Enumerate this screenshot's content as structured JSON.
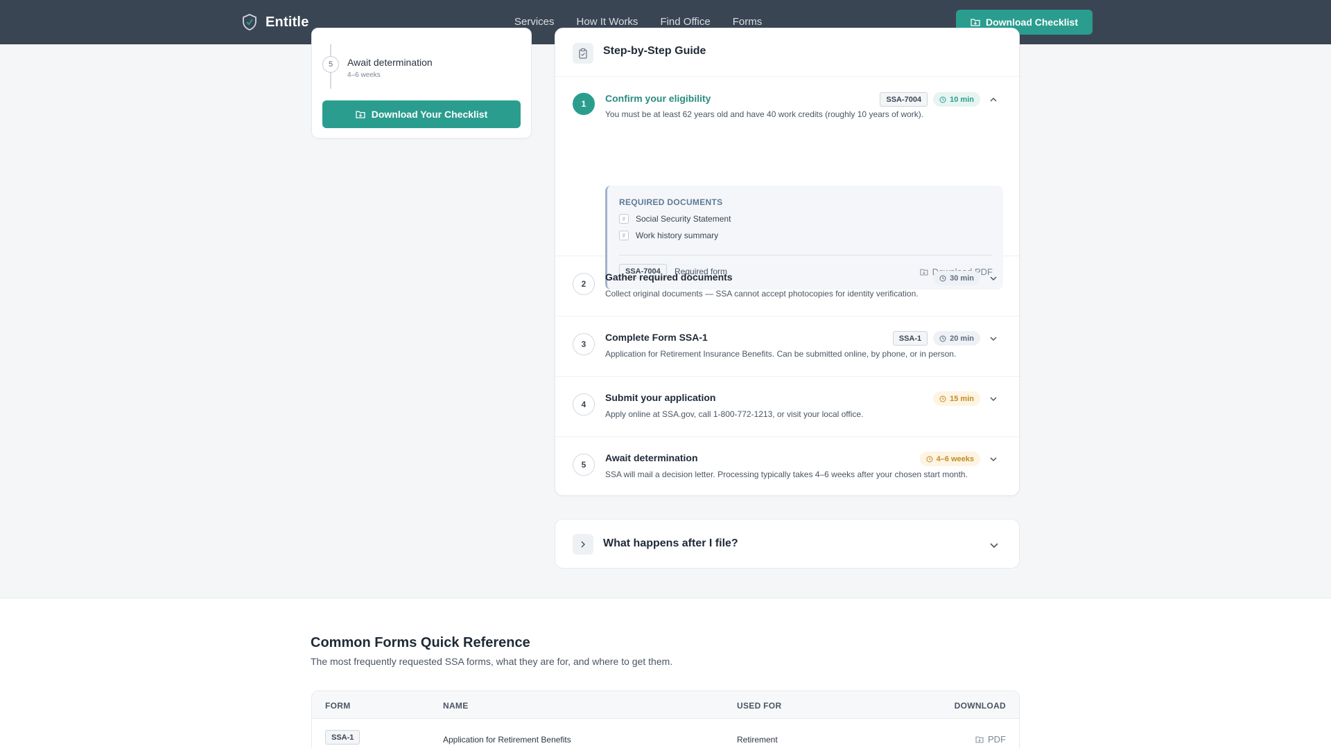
{
  "app": {
    "brand": "Entitle",
    "nav": [
      "Services",
      "How It Works",
      "Find Office",
      "Forms"
    ],
    "cta": "Download Checklist"
  },
  "sidebar": {
    "step_number": "5",
    "step_title": "Await determination",
    "step_duration": "4–6 weeks",
    "download_button": "Download Your Checklist"
  },
  "guide": {
    "title": "Step-by-Step Guide",
    "steps": [
      {
        "number": "1",
        "title": "Confirm your eligibility",
        "description": "You must be at least 62 years old and have 40 work credits (roughly 10 years of work).",
        "form": "SSA-7004",
        "time": "10 min",
        "expanded": true
      },
      {
        "number": "2",
        "title": "Gather required documents",
        "description": "Collect original documents — SSA cannot accept photocopies for identity verification.",
        "time": "30 min"
      },
      {
        "number": "3",
        "title": "Complete Form SSA-1",
        "description": "Application for Retirement Insurance Benefits. Can be submitted online, by phone, or in person.",
        "form": "SSA-1",
        "time": "20 min"
      },
      {
        "number": "4",
        "title": "Submit your application",
        "description": "Apply online at SSA.gov, call 1-800-772-1213, or visit your local office.",
        "time": "15 min"
      },
      {
        "number": "5",
        "title": "Await determination",
        "description": "SSA will mail a decision letter. Processing typically takes 4–6 weeks after your chosen start month.",
        "time": "4–6 weeks"
      }
    ],
    "required_docs": {
      "label": "REQUIRED DOCUMENTS",
      "items": [
        "Social Security Statement",
        "Work history summary"
      ],
      "form_code": "SSA-7004",
      "form_caption": "Required form",
      "download_label": "Download PDF"
    }
  },
  "faq": {
    "title": "What happens after I file?"
  },
  "reference": {
    "title": "Common Forms Quick Reference",
    "subtitle": "The most frequently requested SSA forms, what they are for, and where to get them.",
    "columns": [
      "FORM",
      "NAME",
      "USED FOR",
      "DOWNLOAD"
    ],
    "rows": [
      {
        "form": "SSA-1",
        "name": "Application for Retirement Benefits",
        "used_for": "Retirement",
        "download": "PDF"
      }
    ]
  },
  "colors": {
    "accent": "#2a9d8f",
    "nav_bg": "#3a4553",
    "amber": "#c48a1f"
  }
}
